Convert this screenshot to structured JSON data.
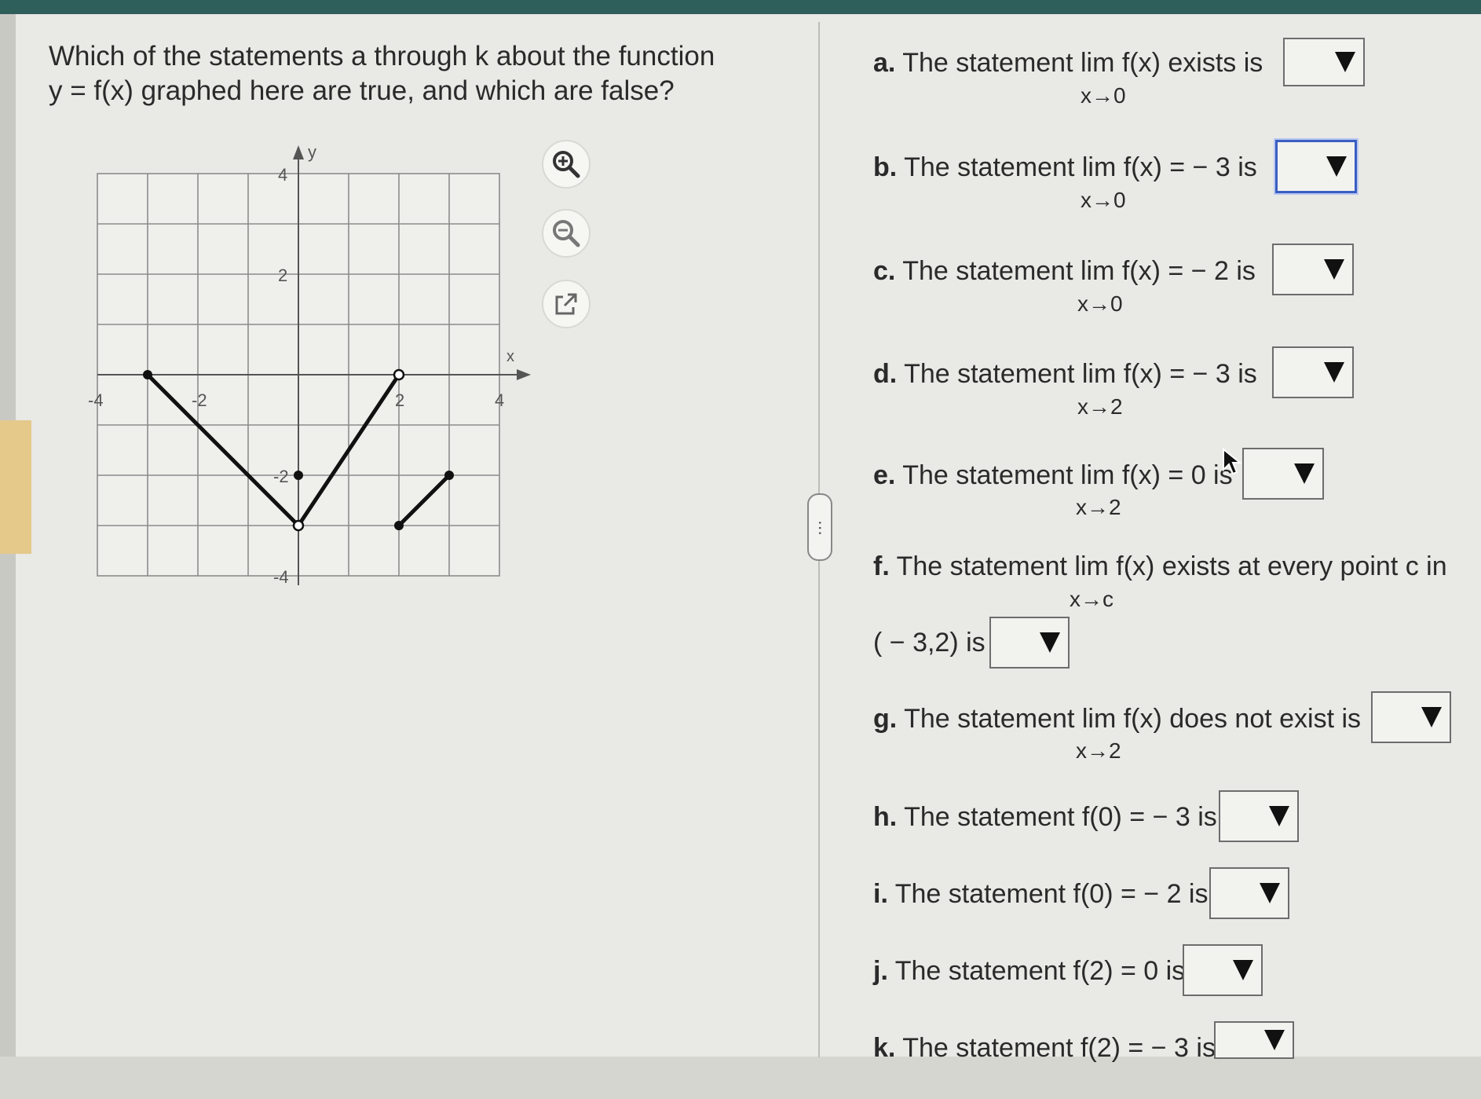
{
  "question": {
    "line1": "Which of the statements a through k about the function",
    "line2": "y = f(x) graphed here are true, and which are false?"
  },
  "graph": {
    "x_axis_label": "x",
    "y_axis_label": "y",
    "x_tick_labels": [
      "-4",
      "-2",
      "2",
      "4"
    ],
    "y_tick_labels": [
      "4",
      "2",
      "-2",
      "-4"
    ]
  },
  "tools": {
    "zoom_in_icon": "magnifier-plus-icon",
    "zoom_out_icon": "magnifier-minus-icon",
    "open_icon": "external-link-icon"
  },
  "handle": {
    "label": "⋯"
  },
  "statements": [
    {
      "label": "a.",
      "text": "The statement  lim f(x) exists is",
      "sub": "x→0",
      "selected": ""
    },
    {
      "label": "b.",
      "text": "The statement  lim f(x) = − 3 is",
      "sub": "x→0",
      "selected": ""
    },
    {
      "label": "c.",
      "text": "The statement  lim f(x) = − 2 is",
      "sub": "x→0",
      "selected": ""
    },
    {
      "label": "d.",
      "text": "The statement  lim f(x) = − 3 is",
      "sub": "x→2",
      "selected": ""
    },
    {
      "label": "e.",
      "text": "The statement  lim f(x) = 0 is",
      "sub": "x→2",
      "selected": ""
    },
    {
      "label": "f.",
      "text": "The statement  lim f(x) exists at every point c in",
      "sub": "x→c",
      "cont": "( − 3,2) is",
      "selected": ""
    },
    {
      "label": "g.",
      "text": "The statement  lim f(x) does not exist is",
      "sub": "x→2",
      "selected": ""
    },
    {
      "label": "h.",
      "text": "The statement f(0) = − 3 is",
      "selected": ""
    },
    {
      "label": "i.",
      "text": "The statement f(0) = − 2 is",
      "selected": ""
    },
    {
      "label": "j.",
      "text": "The statement f(2) = 0 is",
      "selected": ""
    },
    {
      "label": "k.",
      "text": "The statement f(2) = − 3 is",
      "selected": ""
    }
  ],
  "colors": {
    "top_bar": "#2f5f5a",
    "focus_border": "#3a5ec2"
  }
}
